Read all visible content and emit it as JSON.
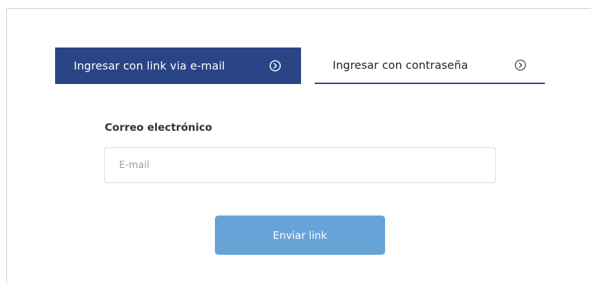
{
  "tabs": {
    "active_label": "Ingresar con link via e-mail",
    "active_icon": "chevron-circle-right-icon",
    "inactive_label": "Ingresar con contraseña",
    "inactive_icon": "chevron-circle-right-icon"
  },
  "form": {
    "email_label": "Correo electrónico",
    "email_placeholder": "E-mail",
    "email_value": "",
    "submit_label": "Enviar link"
  },
  "colors": {
    "active_tab_bg": "#2a4585",
    "button_bg": "#68a3d8",
    "tab_underline": "#2a4585"
  }
}
